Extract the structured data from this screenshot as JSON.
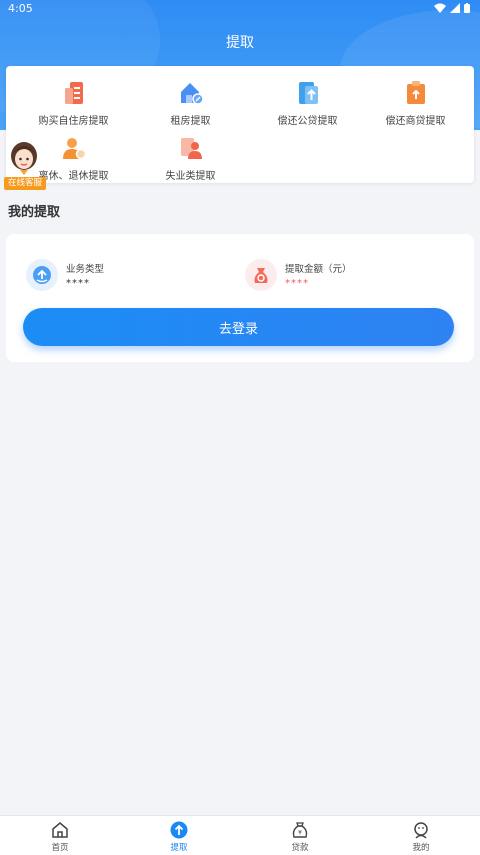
{
  "status_bar": {
    "time": "4:05"
  },
  "header": {
    "title": "提取"
  },
  "services": [
    {
      "label": "购买自住房提取",
      "icon": "building-document-icon"
    },
    {
      "label": "租房提取",
      "icon": "house-icon"
    },
    {
      "label": "偿还公贷提取",
      "icon": "upload-document-icon"
    },
    {
      "label": "偿还商贷提取",
      "icon": "clipboard-upload-icon"
    },
    {
      "label": "离休、退休提取",
      "icon": "person-retire-icon"
    },
    {
      "label": "失业类提取",
      "icon": "person-document-icon"
    }
  ],
  "customer_service": {
    "label": "在线客服"
  },
  "my_withdrawal": {
    "title": "我的提取",
    "business_type": {
      "label": "业务类型",
      "value": "****"
    },
    "amount": {
      "label": "提取金额（元）",
      "value": "****"
    },
    "login_button": "去登录"
  },
  "tabbar": [
    {
      "label": "首页",
      "icon": "home-icon"
    },
    {
      "label": "提取",
      "icon": "arrow-up-circle-icon",
      "active": true
    },
    {
      "label": "贷款",
      "icon": "money-bag-icon"
    },
    {
      "label": "我的",
      "icon": "profile-icon"
    }
  ],
  "colors": {
    "primary": "#2f8cf4",
    "accent_orange": "#f79a1e",
    "amount_red": "#f05a5a"
  }
}
